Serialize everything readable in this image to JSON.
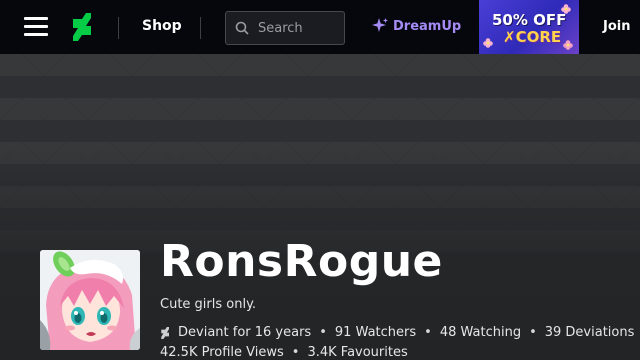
{
  "topbar": {
    "menu_icon": "hamburger-menu-icon",
    "logo_icon": "deviantart-logo-icon",
    "shop_label": "Shop",
    "search": {
      "placeholder": "Search",
      "value": "",
      "icon": "search-icon"
    },
    "dreamup": {
      "label": "DreamUp",
      "icon": "sparkle-icon"
    },
    "promo": {
      "line1": "50% OFF",
      "line2": "CORE",
      "core_mark": "✗"
    },
    "join_label": "Join"
  },
  "profile": {
    "username": "RonsRogue",
    "tagline": "Cute girls only.",
    "deviant_for": "Deviant for 16 years",
    "watchers": "91 Watchers",
    "watching": "48 Watching",
    "deviations": "39 Deviations",
    "profile_views": "42.5K Profile Views",
    "favourites": "3.4K Favourites",
    "separator": "•"
  },
  "colors": {
    "topbar_bg": "#06070d",
    "logo_green": "#05cc47",
    "dreamup_purple": "#a58cf5",
    "page_bg": "#2b2d2f"
  }
}
